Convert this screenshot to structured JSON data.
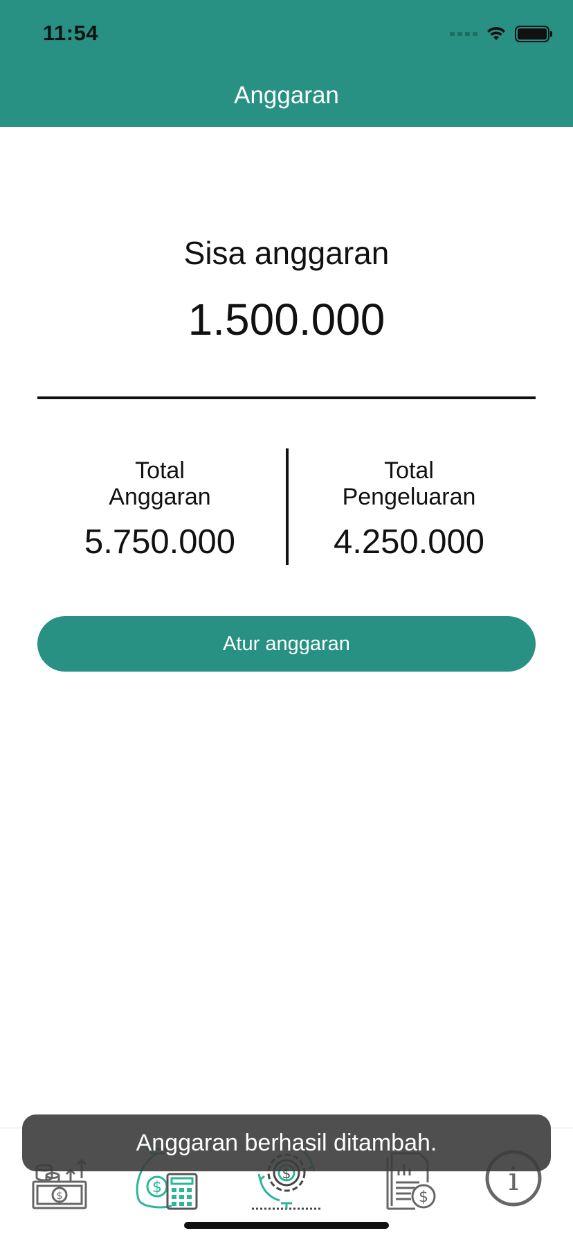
{
  "status": {
    "time": "11:54"
  },
  "header": {
    "title": "Anggaran"
  },
  "summary": {
    "label": "Sisa anggaran",
    "value": "1.500.000"
  },
  "totals": {
    "budget": {
      "label_line1": "Total",
      "label_line2": "Anggaran",
      "value": "5.750.000"
    },
    "expense": {
      "label_line1": "Total",
      "label_line2": "Pengeluaran",
      "value": "4.250.000"
    }
  },
  "actions": {
    "set_budget_label": "Atur anggaran"
  },
  "toast": {
    "message": "Anggaran berhasil ditambah."
  },
  "tabs": [
    {
      "icon": "money-coins-icon"
    },
    {
      "icon": "money-bag-calculator-icon"
    },
    {
      "icon": "gear-dollar-icon"
    },
    {
      "icon": "report-dollar-icon"
    },
    {
      "icon": "info-icon"
    }
  ],
  "colors": {
    "primary": "#289184",
    "toast": "#3c3c3c",
    "icon_gray": "#666666",
    "icon_teal": "#2bb59a"
  }
}
